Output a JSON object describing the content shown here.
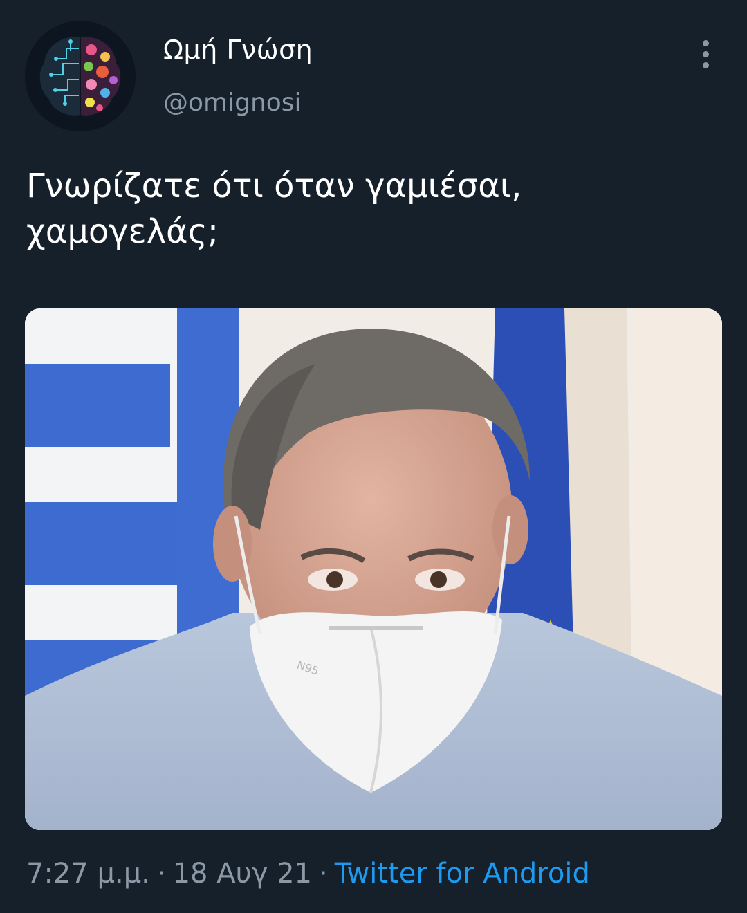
{
  "tweet": {
    "author": {
      "display_name": "Ωμή Γνώση",
      "handle": "@omignosi",
      "avatar_icon": "brain-circuit-flower-avatar"
    },
    "more_icon": "more-vertical-icon",
    "text": "Γνωρίζατε ότι όταν γαμιέσαι,\nχαμογελάς;",
    "media": {
      "type": "photo",
      "alt": "",
      "mask_label": "N95"
    },
    "time": "7:27 μ.μ.",
    "separator": "·",
    "date": "18 Αυγ 21",
    "source": "Twitter for Android"
  },
  "colors": {
    "background": "#15202b",
    "secondary_text": "#8b98a5",
    "link": "#1d9bf0"
  }
}
